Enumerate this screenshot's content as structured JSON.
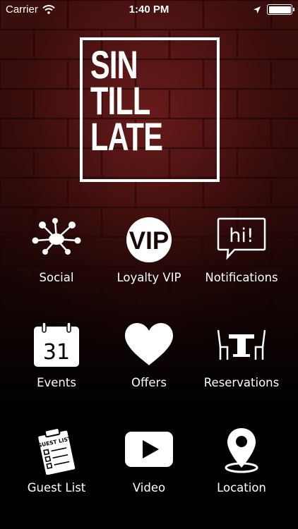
{
  "status_bar": {
    "carrier": "Carrier",
    "time": "1:40 PM",
    "battery_level": 1.0
  },
  "logo": {
    "lines": [
      "SIN",
      "TILL",
      "LATE"
    ]
  },
  "menu": [
    {
      "label": "Social",
      "icon": "network-icon"
    },
    {
      "label": "Loyalty VIP",
      "icon": "vip-badge-icon",
      "icon_text": "VIP"
    },
    {
      "label": "Notifications",
      "icon": "speech-bubble-icon",
      "icon_text": "hi!"
    },
    {
      "label": "Events",
      "icon": "calendar-icon",
      "icon_text": "31"
    },
    {
      "label": "Offers",
      "icon": "heart-icon"
    },
    {
      "label": "Reservations",
      "icon": "table-chairs-icon"
    },
    {
      "label": "Guest List",
      "icon": "clipboard-icon",
      "icon_text": "GUEST LIST"
    },
    {
      "label": "Video",
      "icon": "play-icon"
    },
    {
      "label": "Location",
      "icon": "map-pin-icon"
    }
  ],
  "colors": {
    "background_top": "#3a0f0e",
    "background_bottom": "#000000",
    "foreground": "#ffffff"
  }
}
